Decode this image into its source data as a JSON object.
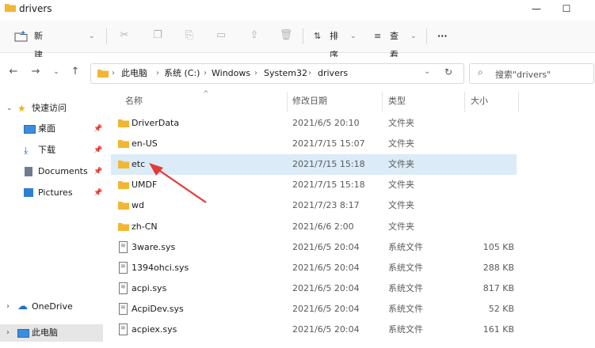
{
  "window": {
    "title": "drivers",
    "minimize_glyph": "—",
    "maximize_glyph": "☐"
  },
  "toolbar": {
    "new_folder": "新建文件夹",
    "sort": "排序",
    "view": "查看",
    "more": "···"
  },
  "address": {
    "crumbs": [
      "此电脑",
      "系统 (C:)",
      "Windows",
      "System32",
      "drivers"
    ],
    "search_placeholder": "搜索\"drivers\""
  },
  "sidebar": {
    "quick_access": "快速访问",
    "items": [
      {
        "label": "桌面",
        "icon": "desktop-icon"
      },
      {
        "label": "下载",
        "icon": "download-icon"
      },
      {
        "label": "Documents",
        "icon": "document-icon"
      },
      {
        "label": "Pictures",
        "icon": "picture-icon"
      }
    ],
    "onedrive": "OneDrive",
    "this_pc": "此电脑"
  },
  "columns": {
    "name": "名称",
    "modified": "修改日期",
    "type": "类型",
    "size": "大小"
  },
  "rows": [
    {
      "name": "DriverData",
      "modified": "2021/6/5 20:10",
      "type": "文件夹",
      "size": "",
      "kind": "folder"
    },
    {
      "name": "en-US",
      "modified": "2021/7/15 15:07",
      "type": "文件夹",
      "size": "",
      "kind": "folder"
    },
    {
      "name": "etc",
      "modified": "2021/7/15 15:18",
      "type": "文件夹",
      "size": "",
      "kind": "folder",
      "selected": true
    },
    {
      "name": "UMDF",
      "modified": "2021/7/15 15:18",
      "type": "文件夹",
      "size": "",
      "kind": "folder"
    },
    {
      "name": "wd",
      "modified": "2021/7/23 8:17",
      "type": "文件夹",
      "size": "",
      "kind": "folder"
    },
    {
      "name": "zh-CN",
      "modified": "2021/6/6 2:00",
      "type": "文件夹",
      "size": "",
      "kind": "folder"
    },
    {
      "name": "3ware.sys",
      "modified": "2021/6/5 20:04",
      "type": "系统文件",
      "size": "105 KB",
      "kind": "file"
    },
    {
      "name": "1394ohci.sys",
      "modified": "2021/6/5 20:04",
      "type": "系统文件",
      "size": "288 KB",
      "kind": "file"
    },
    {
      "name": "acpi.sys",
      "modified": "2021/6/5 20:04",
      "type": "系统文件",
      "size": "817 KB",
      "kind": "file"
    },
    {
      "name": "AcpiDev.sys",
      "modified": "2021/6/5 20:04",
      "type": "系统文件",
      "size": "52 KB",
      "kind": "file"
    },
    {
      "name": "acpiex.sys",
      "modified": "2021/6/5 20:04",
      "type": "系统文件",
      "size": "161 KB",
      "kind": "file"
    }
  ],
  "colors": {
    "folder": "#f2b634",
    "selection": "#dbebf7",
    "annotation_arrow": "#e53935",
    "onedrive": "#1f6fc8",
    "star": "#f0b400"
  }
}
